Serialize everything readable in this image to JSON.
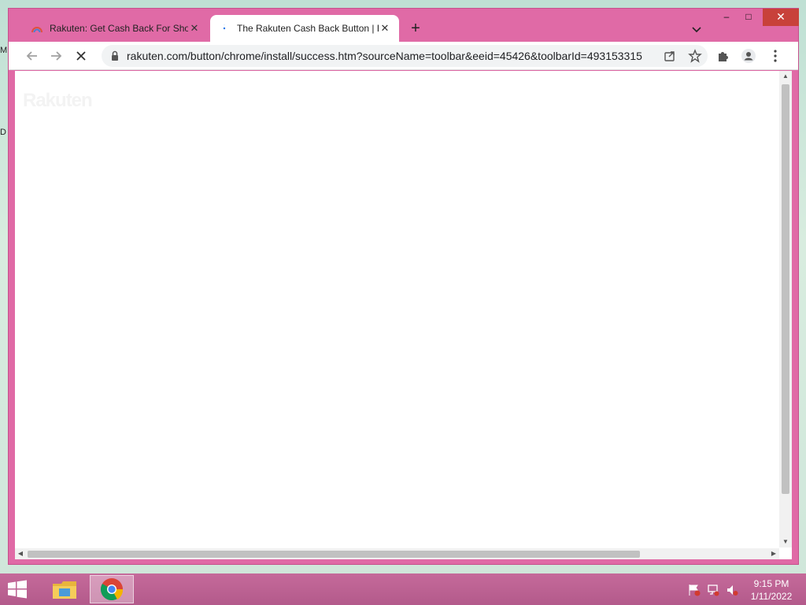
{
  "desktop": {
    "edge_labels": [
      "M",
      "D"
    ]
  },
  "tabs": [
    {
      "title": "Rakuten: Get Cash Back For Shop",
      "active": false
    },
    {
      "title": "The Rakuten Cash Back Button | R",
      "active": true
    }
  ],
  "window_controls": {
    "minimize": "–",
    "maximize": "□",
    "close": "✕"
  },
  "toolbar": {
    "url": "rakuten.com/button/chrome/install/success.htm?sourceName=toolbar&eeid=45426&toolbarId=493153315"
  },
  "page": {
    "ghost_logo": "Rakuten"
  },
  "taskbar": {
    "time": "9:15 PM",
    "date": "1/11/2022"
  },
  "colors": {
    "window_frame": "#e06aa6",
    "taskbar": "#b35a8b",
    "close_button": "#c8413a"
  }
}
